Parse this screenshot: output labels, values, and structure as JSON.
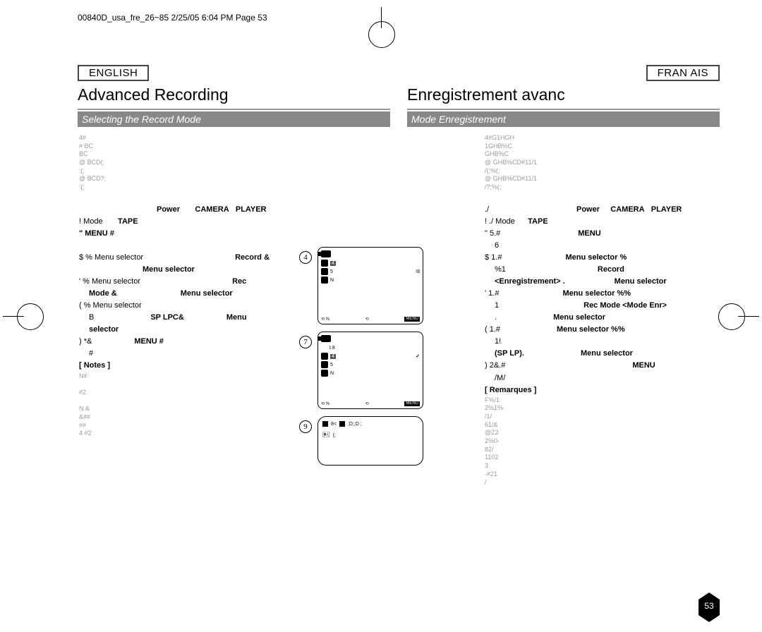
{
  "slug": "00840D_usa_fre_26~85 2/25/05 6:04 PM Page 53",
  "left": {
    "lang": "ENGLISH",
    "title": "Advanced Recording",
    "subleft": "Selecting the Record Mode",
    "b1": "4#",
    "b2": "# BC",
    "b3": "BC",
    "b4": "@   BCD(;",
    "b5": ":(;",
    "b6": "@   BCD?;",
    "b7": ":(;",
    "s1a": "Power",
    "s1b": "CAMERA",
    "s1c": "PLAYER",
    "s2a": "!         Mode",
    "s2b": "TAPE",
    "s3": "\"         MENU #",
    "s4a": "$  %       Menu selector",
    "s4b": "Record &",
    "s5": "Menu selector",
    "s6a": "'  %       Menu selector",
    "s6b": "Rec",
    "s7a": "Mode &",
    "s7b": "Menu selector",
    "s8": "(  %       Menu selector",
    "s9a": "B",
    "s9b": "SP   LPC&",
    "s9c": "Menu",
    "s10": "selector",
    "s11a": ") *&",
    "s11b": "MENU #",
    "s12": "#",
    "notes": "[ Notes ]",
    "n1": "N#",
    "n2": "#2",
    "n3": "N &",
    "n4": "&##",
    "n5": "##",
    "n6": "4 #2"
  },
  "right": {
    "lang": "FRAN  AIS",
    "title": "Enregistrement avanc",
    "subleft": "Mode Enregistrement",
    "b1": "4#G1HGH",
    "b2": "1GHB%C",
    "b3": "GHB%C",
    "b4": "@   GHB%CD#11/1",
    "b5": "/(;%(;",
    "b6": "@   GHB%CD#11/1",
    "b7": "/?;%(;",
    "s0": "./",
    "s1a": "Power",
    "s1b": "CAMERA",
    "s1c": "PLAYER",
    "s2a": "! ./               Mode",
    "s2b": "TAPE",
    "s3": "\" 5.#",
    "s3b": "MENU",
    "s3c": "6",
    "s4a": "$ 1.#",
    "s4b": "Menu selector   %",
    "s5a": "%1",
    "s5b": "Record",
    "s5c": "<Enregistrement>   .",
    "s5d": "Menu selector",
    "s6a": "' 1.#",
    "s6b": "Menu selector   %%",
    "s7a": "1",
    "s7b": "Rec Mode <Mode Enr>",
    "s7c": ".",
    "s7d": "Menu selector",
    "s8a": "(   1.#",
    "s8b": "Menu selector   %%",
    "s9": "1!",
    "s10a": "(SP    LP).",
    "s10b": "Menu selector",
    "s11a": ") 2&.#",
    "s11b": "MENU",
    "s12": "/M/",
    "notes": "[ Remarques ]",
    "n1": "F%/1",
    "n2": "2%1%",
    "n3": "/1/",
    "n4": "61/&",
    "n5": "@Z2",
    "n6": "2%0-",
    "n7": "82/",
    "n8": "1102",
    "n9": "3",
    "n10": "-#21",
    "n11": "/"
  },
  "screens": {
    "c1": "4",
    "lbl1": "4",
    "lbl2": "5",
    "lbl3": "N",
    "ext": "!8",
    "f1": "%",
    "f2": "MENU",
    "c2": "7",
    "t8": "t.8",
    "check": "✓",
    "c3": "9",
    "ss1": "8<",
    "ss2": ";D;;D ;",
    "ss3": "(;"
  },
  "pagenum": "53"
}
